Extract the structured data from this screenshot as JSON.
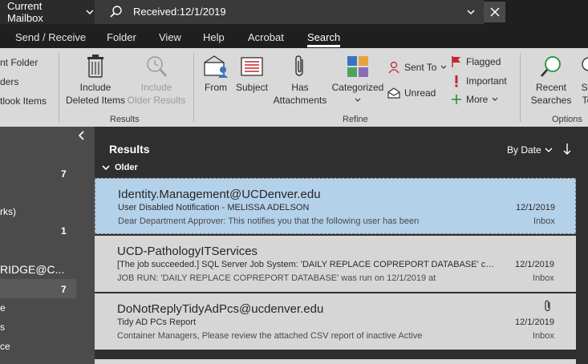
{
  "topbar": {
    "scope_label": "Current Mailbox",
    "search_value": "Received:12/1/2019"
  },
  "tabs": [
    "Send / Receive",
    "Folder",
    "View",
    "Help",
    "Acrobat",
    "Search"
  ],
  "active_tab": "Search",
  "ribbon": {
    "scope_partial": [
      "nt Folder",
      "ders",
      "tlook Items"
    ],
    "include_deleted": [
      "Include",
      "Deleted Items"
    ],
    "include_older": [
      "Include",
      "Older Results"
    ],
    "group_results": "Results",
    "from": "From",
    "subject": "Subject",
    "has_attachments": [
      "Has",
      "Attachments"
    ],
    "categorized": "Categorized",
    "sent_to": "Sent To",
    "unread": "Unread",
    "flagged": "Flagged",
    "important": "Important",
    "more": "More",
    "group_refine": "Refine",
    "recent_searches": [
      "Recent",
      "Searches"
    ],
    "search_tools_partial": [
      "Se",
      "To"
    ],
    "group_options": "Options"
  },
  "nav": {
    "counts": [
      "7",
      "1",
      "7"
    ],
    "items_partial": [
      "rks)",
      "RIDGE@C...",
      "e",
      "s",
      "ce"
    ]
  },
  "results": {
    "title": "Results",
    "sort_label": "By Date",
    "group_label": "Older",
    "messages": [
      {
        "from": "Identity.Management@UCDenver.edu",
        "subject": "User Disabled Notification - MELISSA ADELSON",
        "preview": "Dear Department Approver:  This notifies you that the following user has been",
        "date": "12/1/2019",
        "folder": "Inbox",
        "attachment": false
      },
      {
        "from": "UCD-PathologyITServices",
        "subject": "[The job succeeded.] SQL Server Job System: 'DAILY REPLACE COPREPORT DATABASE' completed on",
        "preview": "JOB RUN:               'DAILY REPLACE COPREPORT DATABASE' was run on 12/1/2019 at",
        "date": "12/1/2019",
        "folder": "Inbox",
        "attachment": false
      },
      {
        "from": "DoNotReplyTidyAdPcs@ucdenver.edu",
        "subject": "Tidy AD PCs Report",
        "preview": "Container Managers,  Please review the attached CSV report of inactive Active",
        "date": "12/1/2019",
        "folder": "Inbox",
        "attachment": true
      }
    ]
  },
  "colors": {
    "selected_row": "#b4d1ea",
    "ribbon_bg": "#d9d9d9",
    "flag_red": "#c4262e",
    "green_plus": "#2e8b3a"
  }
}
